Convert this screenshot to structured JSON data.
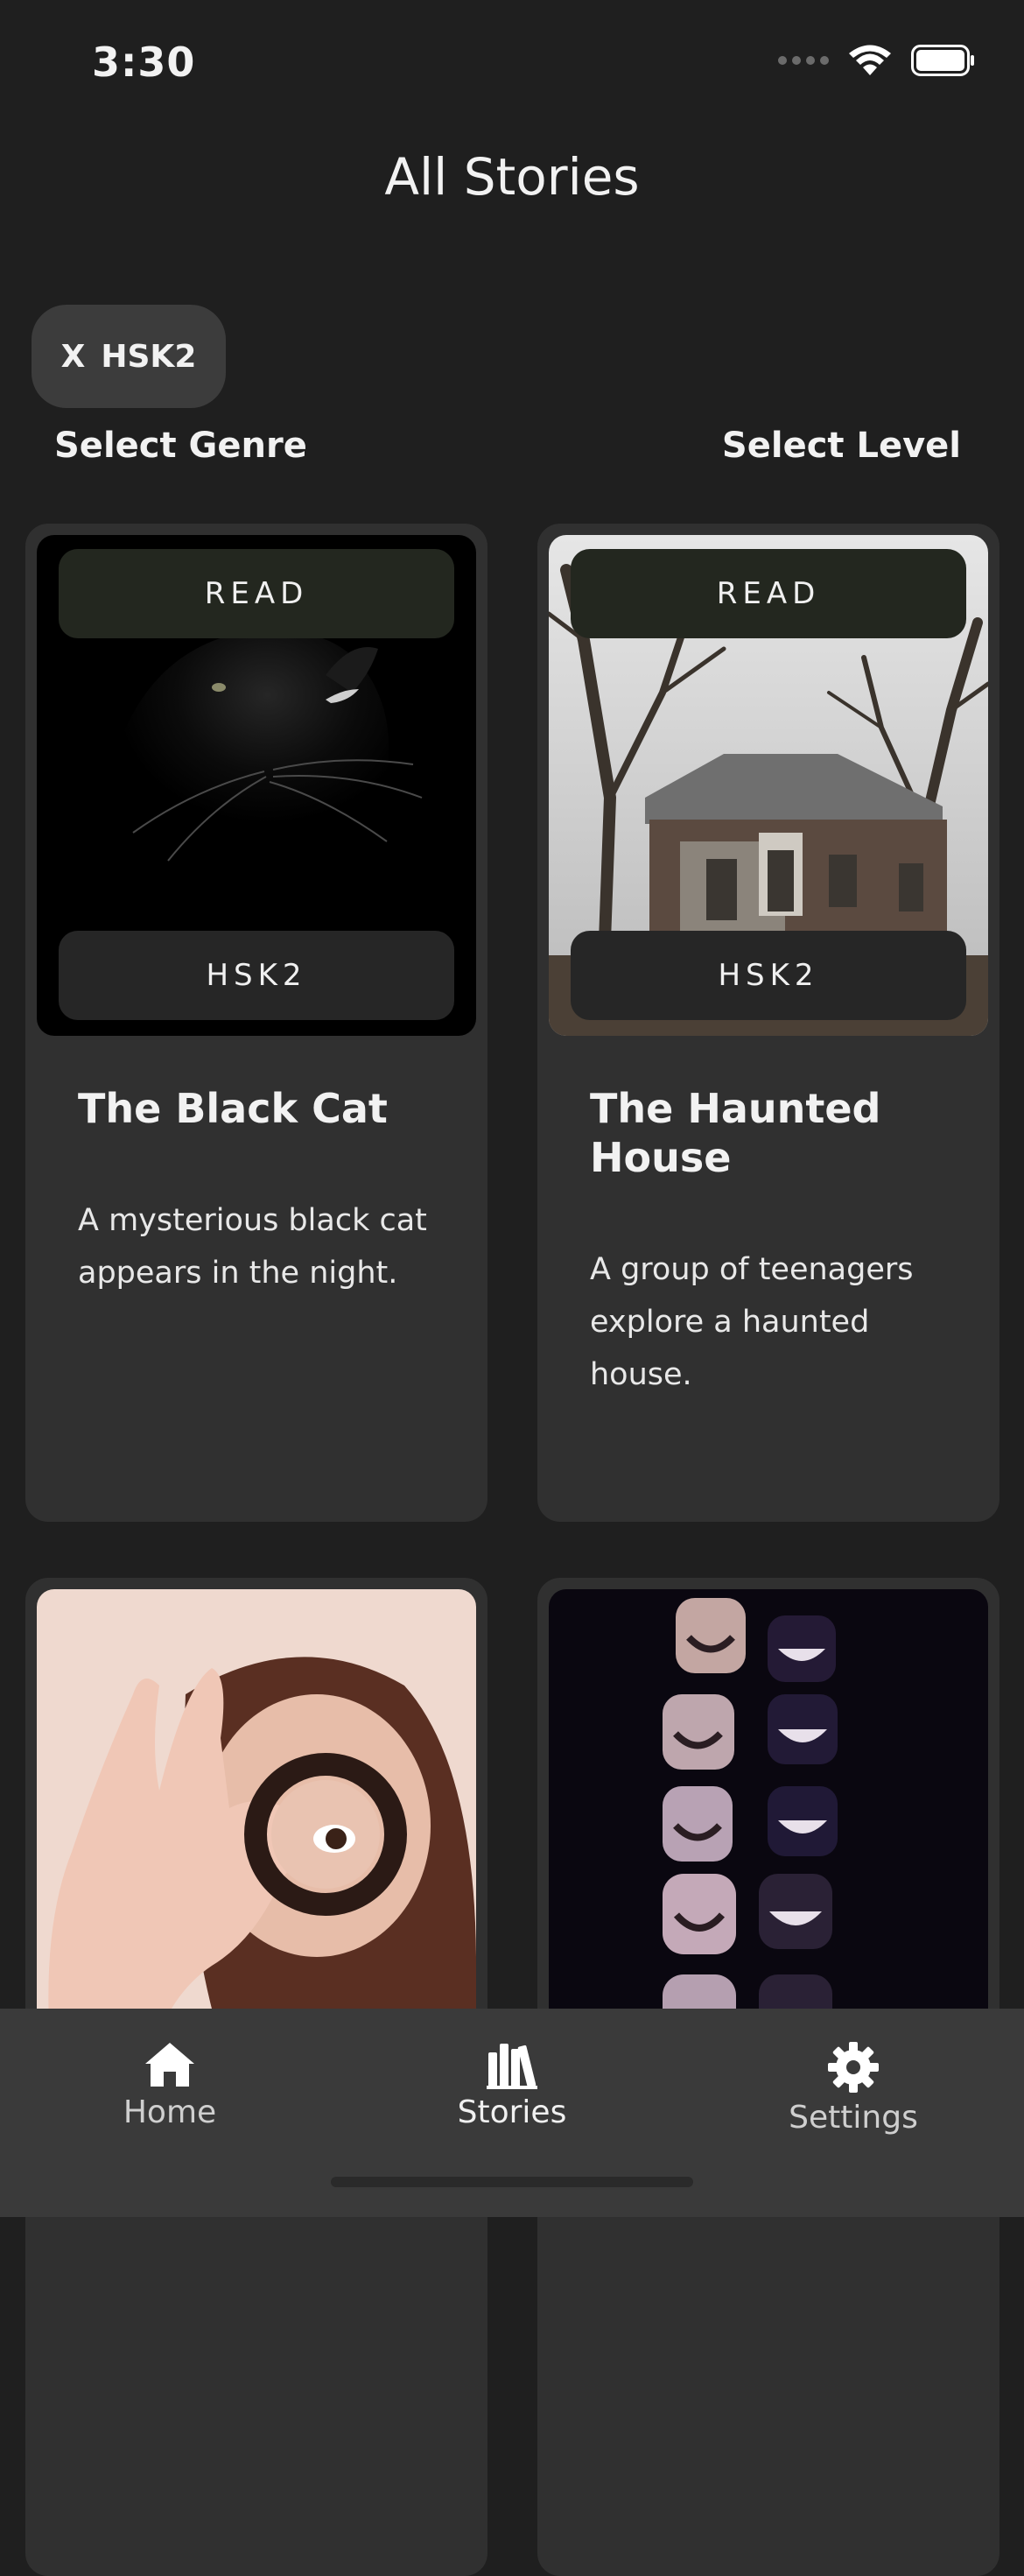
{
  "status_bar": {
    "time": "3:30"
  },
  "header": {
    "title": "All Stories"
  },
  "filter": {
    "chip_close": "X",
    "chip_label": "HSK2"
  },
  "selectors": {
    "genre_label": "Select Genre",
    "level_label": "Select Level"
  },
  "stories": [
    {
      "read_label": "READ",
      "level": "HSK2",
      "title": "The Black Cat",
      "description": "A mysterious black cat appears in the night."
    },
    {
      "read_label": "READ",
      "level": "HSK2",
      "title": "The Haunted House",
      "description": "A group of teenagers explore a haunted house."
    }
  ],
  "tabs": [
    {
      "label": "Home",
      "icon": "house-icon"
    },
    {
      "label": "Stories",
      "icon": "books-icon"
    },
    {
      "label": "Settings",
      "icon": "gear-icon"
    }
  ],
  "active_tab": "Stories",
  "colors": {
    "background": "#1f1f1f",
    "card": "#303030",
    "tab_bar": "#3a3a3a"
  }
}
